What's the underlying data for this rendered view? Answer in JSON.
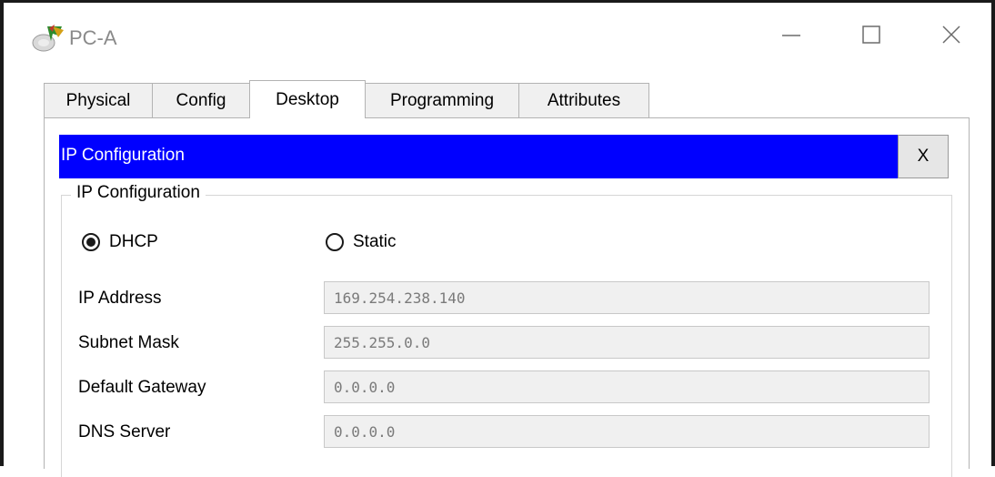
{
  "window": {
    "title": "PC-A",
    "icon": "packet-tracer-pc-icon"
  },
  "tabs": [
    {
      "label": "Physical",
      "active": false
    },
    {
      "label": "Config",
      "active": false
    },
    {
      "label": "Desktop",
      "active": true
    },
    {
      "label": "Programming",
      "active": false
    },
    {
      "label": "Attributes",
      "active": false
    }
  ],
  "ip_config": {
    "header_title": "IP Configuration",
    "close_label": "X",
    "group_legend": "IP Configuration",
    "mode": {
      "dhcp_label": "DHCP",
      "static_label": "Static",
      "selected": "DHCP"
    },
    "fields": {
      "ip_address": {
        "label": "IP Address",
        "value": "169.254.238.140"
      },
      "subnet_mask": {
        "label": "Subnet Mask",
        "value": "255.255.0.0"
      },
      "default_gateway": {
        "label": "Default Gateway",
        "value": "0.0.0.0"
      },
      "dns_server": {
        "label": "DNS Server",
        "value": "0.0.0.0"
      }
    }
  },
  "colors": {
    "header_bg": "#0000ff",
    "header_text": "#ffffff",
    "tab_bg": "#f0f0f0",
    "input_bg": "#f0f0f0",
    "input_text": "#7a7a7a"
  }
}
